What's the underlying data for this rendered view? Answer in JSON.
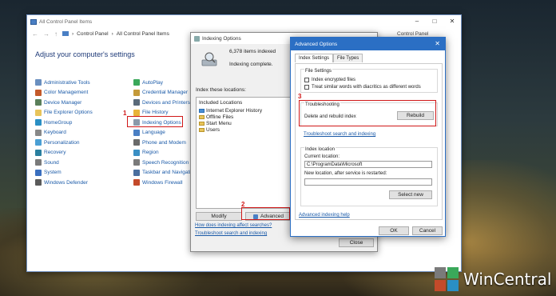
{
  "control_panel": {
    "title": "All Control Panel Items",
    "breadcrumb": [
      "Control Panel",
      "All Control Panel Items"
    ],
    "search_placeholder": "Control Panel",
    "heading": "Adjust your computer's settings",
    "col1": [
      {
        "label": "Administrative Tools",
        "color": "#6a8fbf"
      },
      {
        "label": "Color Management",
        "color": "#c45a2a"
      },
      {
        "label": "Device Manager",
        "color": "#5a7f5a"
      },
      {
        "label": "File Explorer Options",
        "color": "#e8c45a"
      },
      {
        "label": "HomeGroup",
        "color": "#2a8fc4"
      },
      {
        "label": "Keyboard",
        "color": "#888888"
      },
      {
        "label": "Personalization",
        "color": "#4a9fd4"
      },
      {
        "label": "Recovery",
        "color": "#2a7f9f"
      },
      {
        "label": "Sound",
        "color": "#7a7a7a"
      },
      {
        "label": "System",
        "color": "#3a6fbf"
      },
      {
        "label": "Windows Defender",
        "color": "#5a5a5a"
      }
    ],
    "col2": [
      {
        "label": "AutoPlay",
        "color": "#3aa85a"
      },
      {
        "label": "Credential Manager",
        "color": "#c49a3a"
      },
      {
        "label": "Devices and Printers",
        "color": "#5a6a7a"
      },
      {
        "label": "File History",
        "color": "#e8b43a"
      },
      {
        "label": "Indexing Options",
        "color": "#8a9aaa"
      },
      {
        "label": "Language",
        "color": "#4a7fc4"
      },
      {
        "label": "Phone and Modem",
        "color": "#6a6a6a"
      },
      {
        "label": "Region",
        "color": "#3a8fc4"
      },
      {
        "label": "Speech Recognition",
        "color": "#7a7a7a"
      },
      {
        "label": "Taskbar and Navigation",
        "color": "#4a6f9f"
      },
      {
        "label": "Windows Firewall",
        "color": "#c44a2a"
      }
    ]
  },
  "indexing": {
    "title": "Indexing Options",
    "count": "6,378 items indexed",
    "status": "Indexing complete.",
    "index_label": "Index these locations:",
    "included_header": "Included Locations",
    "locations": [
      "Internet Explorer History",
      "Offline Files",
      "Start Menu",
      "Users"
    ],
    "modify": "Modify",
    "advanced": "Advanced",
    "link1": "How does indexing affect searches?",
    "link2": "Troubleshoot search and indexing",
    "close": "Close"
  },
  "advanced": {
    "title": "Advanced Options",
    "tab1": "Index Settings",
    "tab2": "File Types",
    "file_settings": "File Settings",
    "chk1": "Index encrypted files",
    "chk2": "Treat similar words with diacritics as different words",
    "troubleshooting": "Troubleshooting",
    "delete_rebuild": "Delete and rebuild index",
    "rebuild": "Rebuild",
    "troubleshoot_link": "Troubleshoot search and indexing",
    "index_location": "Index location",
    "current_location": "Current location:",
    "current_path": "C:\\ProgramData\\Microsoft",
    "new_location": "New location, after service is restarted:",
    "select_new": "Select new",
    "help_link": "Advanced indexing help",
    "ok": "OK",
    "cancel": "Cancel"
  },
  "annotations": [
    "1",
    "2",
    "3"
  ],
  "watermark": "WinCentral"
}
